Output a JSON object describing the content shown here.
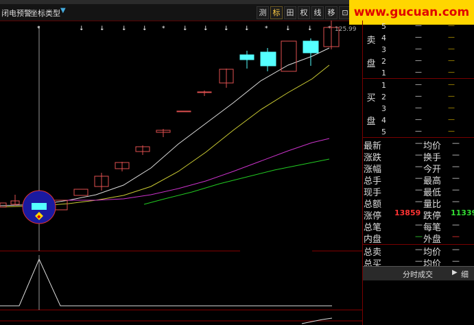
{
  "toolbar": {
    "alert_label": "闭电预警",
    "coord_type_label": "坐标类型",
    "buttons": [
      "测",
      "标",
      "田",
      "权",
      "线",
      "移",
      "⊡"
    ],
    "active_buttons": [
      "标"
    ]
  },
  "watermark": {
    "text": "www.gucuan.com"
  },
  "chart": {
    "price_label": "125.99"
  },
  "order_book": {
    "sell_label": "卖盘",
    "buy_label": "买盘",
    "sell_levels": [
      {
        "level": "5",
        "price": "—",
        "volume": "—"
      },
      {
        "level": "4",
        "price": "—",
        "volume": "—"
      },
      {
        "level": "3",
        "price": "—",
        "volume": "—"
      },
      {
        "level": "2",
        "price": "—",
        "volume": "—"
      },
      {
        "level": "1",
        "price": "—",
        "volume": "—"
      }
    ],
    "buy_levels": [
      {
        "level": "1",
        "price": "—",
        "volume": "—"
      },
      {
        "level": "2",
        "price": "—",
        "volume": "—"
      },
      {
        "level": "3",
        "price": "—",
        "volume": "—"
      },
      {
        "level": "4",
        "price": "—",
        "volume": "—"
      },
      {
        "level": "5",
        "price": "—",
        "volume": "—"
      }
    ]
  },
  "quote": {
    "rows": [
      {
        "left": "最新",
        "right": "均价"
      },
      {
        "left": "涨跌",
        "right": "换手"
      },
      {
        "left": "涨幅",
        "right": "今开"
      },
      {
        "left": "总手",
        "right": "最高"
      },
      {
        "left": "现手",
        "right": "最低"
      },
      {
        "left": "总额",
        "right": "量比"
      },
      {
        "left": "涨停",
        "left_value": "13859",
        "right": "跌停",
        "right_value": "11339"
      },
      {
        "left": "总笔",
        "right": "每笔"
      },
      {
        "left": "内盘",
        "right": "外盘"
      },
      {
        "left": "总卖",
        "right": "均价"
      },
      {
        "left": "总买",
        "right": "均价"
      }
    ],
    "dash": "—",
    "colors": {
      "limit_up": "#ff3333",
      "limit_down": "#33dd33"
    }
  },
  "bottom_bar": {
    "label": "分时成交",
    "toggle_icon": "right-arrow-icon",
    "detail_label": "细"
  }
}
